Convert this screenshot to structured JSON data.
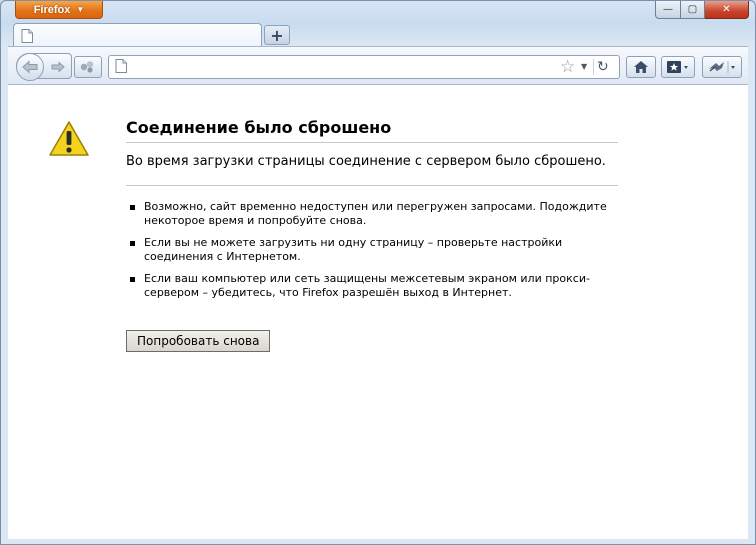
{
  "window": {
    "app_button_label": "Firefox",
    "app_button_arrow": "▼",
    "controls": {
      "minimize": "—",
      "maximize": "▢",
      "close": "✕"
    }
  },
  "tabs": {
    "new_tab_label": "+"
  },
  "toolbar": {
    "url_value": "",
    "url_placeholder": ""
  },
  "error_page": {
    "title": "Соединение было сброшено",
    "short_desc": "Во время загрузки страницы соединение с сервером было сброшено.",
    "suggestions": [
      "Возможно, сайт временно недоступен или перегружен запросами. Подождите некоторое время и попробуйте снова.",
      "Если вы не можете загрузить ни одну страницу – проверьте настройки соединения с Интернетом.",
      "Если ваш компьютер или сеть защищены межсетевым экраном или прокси-сервером – убедитесь, что Firefox разрешён выход в Интернет."
    ],
    "retry_label": "Попробовать снова"
  },
  "icons": {
    "app_menu": "firefox-menu-icon",
    "back": "back-arrow-icon",
    "forward": "forward-arrow-icon",
    "bookmark_star": "star-icon",
    "reload": "reload-icon",
    "home": "home-icon",
    "bookmarks": "bookmarks-icon",
    "addon": "addon-icon",
    "warning": "warning-icon"
  },
  "colors": {
    "firefox_orange": "#e3751b",
    "close_red": "#c9442a",
    "warning_yellow": "#f3d31c"
  }
}
